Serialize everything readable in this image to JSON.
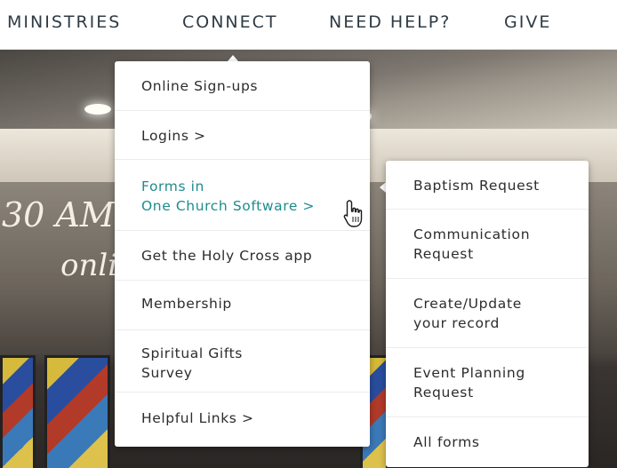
{
  "nav": {
    "items": [
      "MINISTRIES",
      "CONNECT",
      "NEED HELP?",
      "GIVE"
    ]
  },
  "background": {
    "text_time": "30 AM",
    "text_online": "onli"
  },
  "connect_menu": {
    "items": [
      {
        "lines": [
          "Online Sign-ups"
        ]
      },
      {
        "lines": [
          "Logins >"
        ]
      },
      {
        "lines": [
          "Forms in",
          "One Church Software >"
        ],
        "active": true
      },
      {
        "lines": [
          "Get the Holy Cross app"
        ]
      },
      {
        "lines": [
          "Membership"
        ]
      },
      {
        "lines": [
          "Spiritual Gifts",
          "Survey"
        ]
      },
      {
        "lines": [
          "Helpful Links >"
        ]
      }
    ]
  },
  "forms_submenu": {
    "items": [
      {
        "lines": [
          "Baptism Request"
        ]
      },
      {
        "lines": [
          "Communication",
          "Request"
        ]
      },
      {
        "lines": [
          "Create/Update",
          "your record"
        ]
      },
      {
        "lines": [
          "Event Planning",
          "Request"
        ]
      },
      {
        "lines": [
          "All forms"
        ]
      }
    ]
  },
  "colors": {
    "active": "#1e8c8c",
    "nav_text": "#2f3b44"
  }
}
